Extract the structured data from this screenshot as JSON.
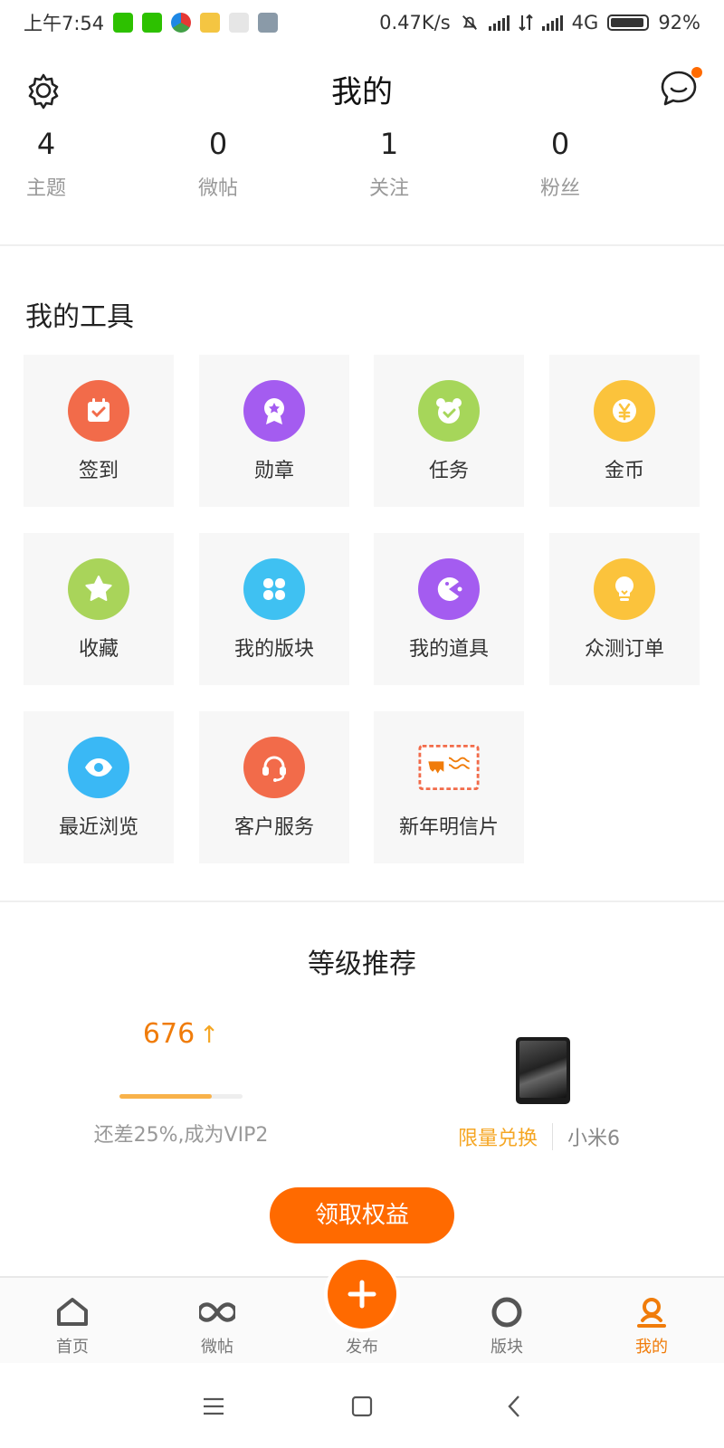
{
  "status_bar": {
    "time": "上午7:54",
    "speed": "0.47K/s",
    "network": "4G",
    "battery": "92%"
  },
  "header": {
    "title": "我的"
  },
  "stats": [
    {
      "value": "4",
      "label": "主题"
    },
    {
      "value": "0",
      "label": "微帖"
    },
    {
      "value": "1",
      "label": "关注"
    },
    {
      "value": "0",
      "label": "粉丝"
    }
  ],
  "tools": {
    "title": "我的工具",
    "items": [
      {
        "label": "签到",
        "icon": "calendar-check-icon",
        "color": "#f26b4a"
      },
      {
        "label": "勋章",
        "icon": "medal-icon",
        "color": "#a45cf0"
      },
      {
        "label": "任务",
        "icon": "task-bear-icon",
        "color": "#a6d65a"
      },
      {
        "label": "金币",
        "icon": "yuan-coin-icon",
        "color": "#fbc33c"
      },
      {
        "label": "收藏",
        "icon": "star-icon",
        "color": "#a9d45a"
      },
      {
        "label": "我的版块",
        "icon": "grid-petal-icon",
        "color": "#3fc1f2"
      },
      {
        "label": "我的道具",
        "icon": "pacman-icon",
        "color": "#a45cf0"
      },
      {
        "label": "众测订单",
        "icon": "lightbulb-icon",
        "color": "#fbc33c"
      },
      {
        "label": "最近浏览",
        "icon": "eye-icon",
        "color": "#3ab8f5"
      },
      {
        "label": "客户服务",
        "icon": "headset-icon",
        "color": "#f26b4a"
      },
      {
        "label": "新年明信片",
        "icon": "postcard-icon",
        "color": "#f07c0a"
      }
    ]
  },
  "recommend": {
    "title": "等级推荐",
    "points": "676",
    "progress": 0.75,
    "hint": "还差25%,成为VIP2",
    "exchange_label": "限量兑换",
    "product": "小米6",
    "claim_button": "领取权益"
  },
  "tabbar": [
    {
      "label": "首页",
      "icon": "home-icon"
    },
    {
      "label": "微帖",
      "icon": "infinity-icon"
    },
    {
      "label": "发布",
      "icon": "plus-icon"
    },
    {
      "label": "版块",
      "icon": "ring-icon"
    },
    {
      "label": "我的",
      "icon": "person-icon"
    }
  ],
  "colors": {
    "accent": "#ff6a00",
    "accent_text": "#f07c0a",
    "tile_bg": "#f7f7f7"
  }
}
